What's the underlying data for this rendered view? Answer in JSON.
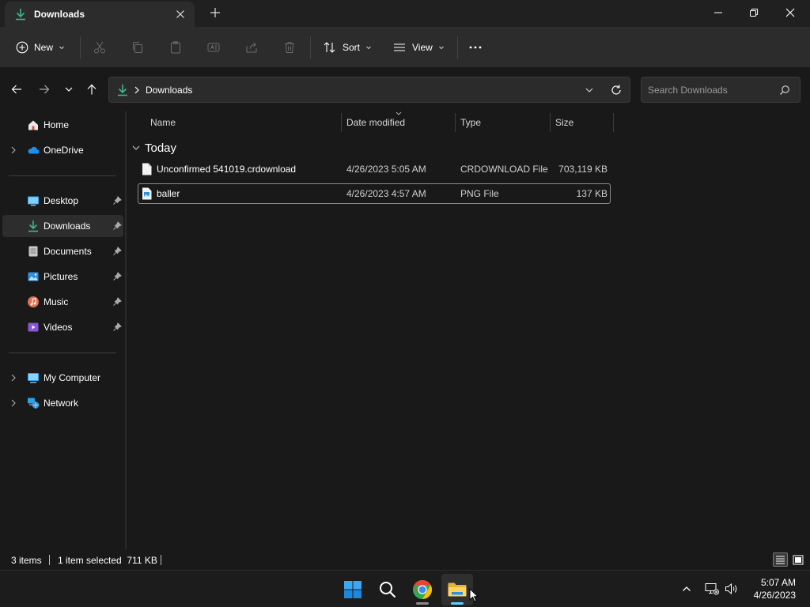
{
  "window": {
    "tab_title": "Downloads",
    "new_tab_symbol": "+"
  },
  "toolbar": {
    "new_label": "New",
    "sort_label": "Sort",
    "view_label": "View",
    "more_symbol": "•••"
  },
  "address": {
    "path": "Downloads",
    "search_placeholder": "Search Downloads"
  },
  "sidebar": {
    "items": [
      {
        "label": "Home"
      },
      {
        "label": "OneDrive"
      },
      {
        "label": "Desktop"
      },
      {
        "label": "Downloads"
      },
      {
        "label": "Documents"
      },
      {
        "label": "Pictures"
      },
      {
        "label": "Music"
      },
      {
        "label": "Videos"
      },
      {
        "label": "My Computer"
      },
      {
        "label": "Network"
      }
    ],
    "selected": "Downloads"
  },
  "columns": {
    "name": "Name",
    "date": "Date modified",
    "type": "Type",
    "size": "Size"
  },
  "group": {
    "label": "Today"
  },
  "files": [
    {
      "name": "Unconfirmed 541019.crdownload",
      "date": "4/26/2023 5:05 AM",
      "type": "CRDOWNLOAD File",
      "size": "703,119 KB",
      "icon": "blank-file-icon"
    },
    {
      "name": "baller",
      "date": "4/26/2023 4:57 AM",
      "type": "PNG File",
      "size": "137 KB",
      "icon": "image-file-icon",
      "selected": true
    }
  ],
  "status": {
    "count": "3 items",
    "selection": "1 item selected  711 KB"
  },
  "taskbar": {
    "time": "5:07 AM",
    "date": "4/26/2023"
  },
  "colors": {
    "accent": "#60cdff",
    "downloads_green": "#3fb68b",
    "background": "#191919"
  }
}
